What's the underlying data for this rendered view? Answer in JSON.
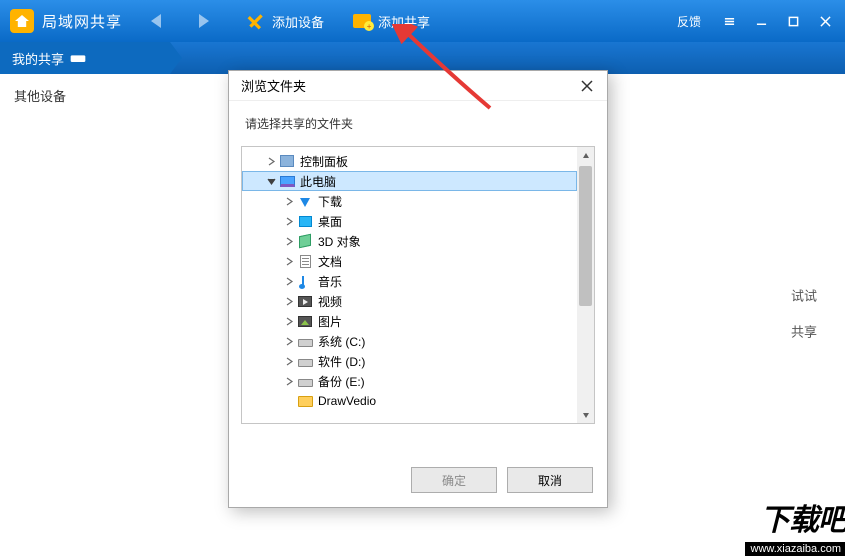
{
  "titlebar": {
    "app_title": "局域网共享",
    "add_device": "添加设备",
    "add_share": "添加共享",
    "feedback": "反馈"
  },
  "sidebar": {
    "tab_active": "我的共享",
    "other_devices": "其他设备"
  },
  "hints": {
    "try": "试试",
    "share": "共享"
  },
  "dialog": {
    "title": "浏览文件夹",
    "prompt": "请选择共享的文件夹",
    "ok": "确定",
    "cancel": "取消"
  },
  "tree": [
    {
      "indent": 1,
      "exp": "right",
      "icon": "panel",
      "label": "控制面板"
    },
    {
      "indent": 1,
      "exp": "down",
      "icon": "pc",
      "label": "此电脑",
      "selected": true
    },
    {
      "indent": 2,
      "exp": "right",
      "icon": "down",
      "label": "下载"
    },
    {
      "indent": 2,
      "exp": "right",
      "icon": "desk",
      "label": "桌面"
    },
    {
      "indent": 2,
      "exp": "right",
      "icon": "3d",
      "label": "3D 对象"
    },
    {
      "indent": 2,
      "exp": "right",
      "icon": "doc",
      "label": "文档"
    },
    {
      "indent": 2,
      "exp": "right",
      "icon": "music",
      "label": "音乐"
    },
    {
      "indent": 2,
      "exp": "right",
      "icon": "video",
      "label": "视频"
    },
    {
      "indent": 2,
      "exp": "right",
      "icon": "pic",
      "label": "图片"
    },
    {
      "indent": 2,
      "exp": "right",
      "icon": "drive",
      "label": "系统 (C:)"
    },
    {
      "indent": 2,
      "exp": "right",
      "icon": "drive",
      "label": "软件 (D:)"
    },
    {
      "indent": 2,
      "exp": "right",
      "icon": "drive",
      "label": "备份 (E:)"
    },
    {
      "indent": 2,
      "exp": "none",
      "icon": "folder",
      "label": "DrawVedio"
    }
  ],
  "watermark": {
    "big": "下载吧",
    "url": "www.xiazaiba.com"
  }
}
